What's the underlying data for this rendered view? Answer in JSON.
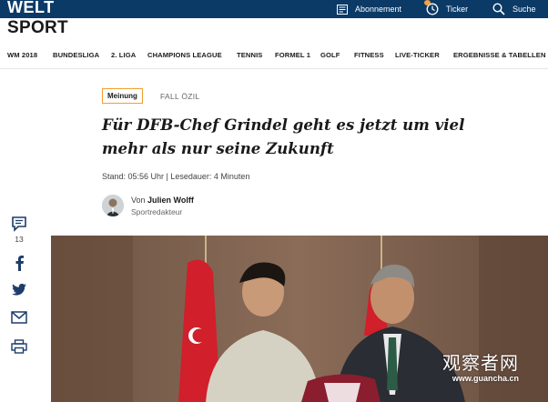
{
  "header": {
    "logo": "WELT",
    "subscription_label": "Abonnement",
    "ticker_label": "Ticker",
    "search_label": "Suche"
  },
  "section": {
    "title": "SPORT"
  },
  "sport_nav": [
    "WM 2018",
    "BUNDESLIGA",
    "2. LIGA",
    "CHAMPIONS LEAGUE",
    "TENNIS",
    "FORMEL 1",
    "GOLF",
    "FITNESS",
    "LIVE-TICKER",
    "ERGEBNISSE & TABELLEN"
  ],
  "article": {
    "badge": "Meinung",
    "topic": "FALL ÖZIL",
    "headline": "Für DFB-Chef Grindel geht es jetzt um viel mehr als nur seine Zukunft",
    "meta": "Stand: 05:56 Uhr | Lesedauer: 4 Minuten",
    "author_prefix": "Von",
    "author_name": "Julien Wolff",
    "author_role": "Sportredakteur"
  },
  "share": {
    "comment_count": "13"
  },
  "watermark": {
    "line1": "观察者网",
    "line2": "www.guancha.cn"
  },
  "colors": {
    "topbar": "#0b3a66",
    "badge_border": "#f0a030",
    "ticker_dot": "#f2a23a",
    "share_icons": "#1d3d6b"
  },
  "icons": [
    "subscription-icon",
    "clock-icon",
    "search-icon",
    "comment-icon",
    "facebook-icon",
    "twitter-icon",
    "mail-icon",
    "print-icon"
  ]
}
